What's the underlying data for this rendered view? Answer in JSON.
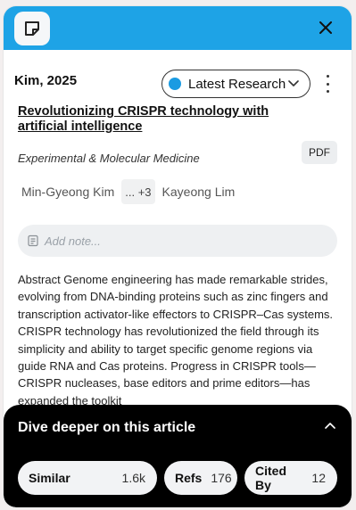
{
  "header": {
    "logo_icon": "note-icon",
    "close_icon": "close-icon",
    "accent_color": "#1ea3e6"
  },
  "paper": {
    "citation": "Kim, 2025",
    "collection": {
      "label": "Latest Research",
      "dot_color": "#1a9be2"
    },
    "title": "Revolutionizing CRISPR technology with artificial intelligence",
    "journal": "Experimental & Molecular Medicine",
    "pdf_label": "PDF",
    "authors": {
      "first": "Min-Gyeong Kim",
      "more": "... +3",
      "last": "Kayeong Lim"
    },
    "note_placeholder": "Add note...",
    "abstract": "Abstract Genome engineering has made remarkable strides, evolving from DNA-binding proteins such as zinc fingers and transcription activator-like effectors to CRISPR–Cas systems. CRISPR technology has revolutionized the field through its simplicity and ability to target specific genome regions via guide RNA and Cas proteins. Progress in CRISPR tools—CRISPR nucleases, base editors and prime editors—has expanded the toolkit"
  },
  "deeper": {
    "title": "Dive deeper on this article",
    "pills": [
      {
        "label": "Similar",
        "count": "1.6k"
      },
      {
        "label": "Refs",
        "count": "176"
      },
      {
        "label": "Cited By",
        "count": "12"
      }
    ]
  }
}
